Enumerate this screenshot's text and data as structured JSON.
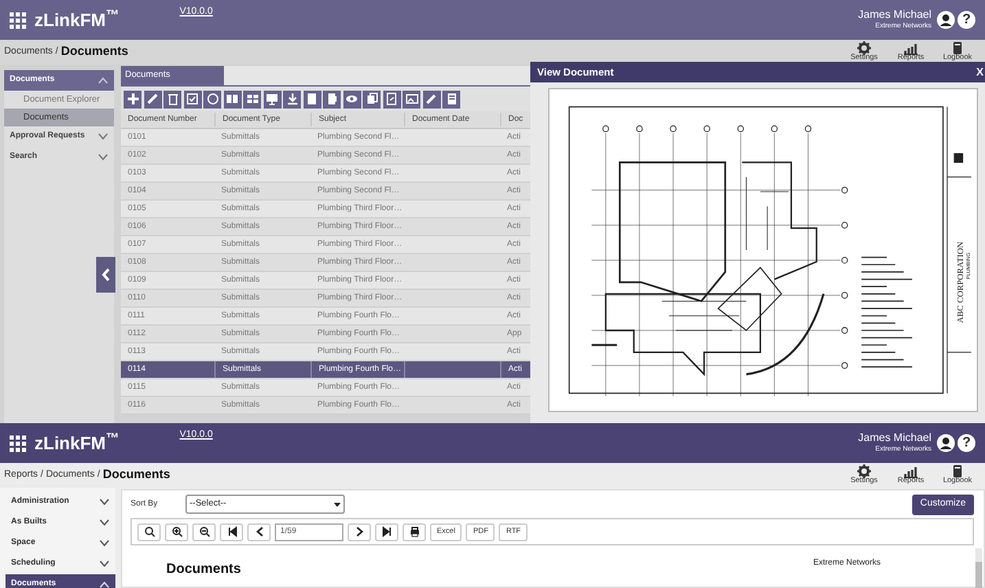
{
  "top_screen": {
    "header": {
      "logo": "zLinkFM$^{™}$",
      "version": "V10.0.0",
      "user_name": "James Michael",
      "organization": "Extreme Networks",
      "help": "?"
    },
    "breadcrumb": {
      "parents": [
        "Documents"
      ],
      "separator": "/",
      "current": "Documents"
    },
    "shortcuts": [
      {
        "label": "Settings"
      },
      {
        "label": "Reports"
      },
      {
        "label": "Logbook"
      }
    ],
    "sidebar": [
      {
        "label": "Documents",
        "expanded": true,
        "children": [
          {
            "label": "Document Explorer",
            "selected": false
          },
          {
            "label": "Documents",
            "selected": true
          }
        ]
      },
      {
        "label": "Approval Requests",
        "expanded": false
      },
      {
        "label": "Search",
        "expanded": false
      }
    ],
    "panel_tab": "Documents",
    "table": {
      "columns": [
        "Document Number",
        "Document Type",
        "Subject",
        "Document Date",
        "Doc"
      ],
      "rows": [
        {
          "cells": [
            "0101",
            "Submittals",
            "Plumbing Second Fl…",
            "",
            "Acti"
          ],
          "selected": false
        },
        {
          "cells": [
            "0102",
            "Submittals",
            "Plumbing Second Fl…",
            "",
            "Acti"
          ],
          "selected": false
        },
        {
          "cells": [
            "0103",
            "Submittals",
            "Plumbing Second Fl…",
            "",
            "Acti"
          ],
          "selected": false
        },
        {
          "cells": [
            "0104",
            "Submittals",
            "Plumbing Second Fl…",
            "",
            "Acti"
          ],
          "selected": false
        },
        {
          "cells": [
            "0105",
            "Submittals",
            "Plumbing Third Floor…",
            "",
            "Acti"
          ],
          "selected": false
        },
        {
          "cells": [
            "0106",
            "Submittals",
            "Plumbing Third Floor…",
            "",
            "Acti"
          ],
          "selected": false
        },
        {
          "cells": [
            "0107",
            "Submittals",
            "Plumbing Third Floor…",
            "",
            "Acti"
          ],
          "selected": false
        },
        {
          "cells": [
            "0108",
            "Submittals",
            "Plumbing Third Floor…",
            "",
            "Acti"
          ],
          "selected": false
        },
        {
          "cells": [
            "0109",
            "Submittals",
            "Plumbing Third Floor…",
            "",
            "Acti"
          ],
          "selected": false
        },
        {
          "cells": [
            "0110",
            "Submittals",
            "Plumbing Third Floor…",
            "",
            "Acti"
          ],
          "selected": false
        },
        {
          "cells": [
            "0111",
            "Submittals",
            "Plumbing Fourth Flo…",
            "",
            "Acti"
          ],
          "selected": false
        },
        {
          "cells": [
            "0112",
            "Submittals",
            "Plumbing Fourth Flo…",
            "",
            "App"
          ],
          "selected": false
        },
        {
          "cells": [
            "0113",
            "Submittals",
            "Plumbing Fourth Flo…",
            "",
            "Acti"
          ],
          "selected": false
        },
        {
          "cells": [
            "0114",
            "Submittals",
            "Plumbing Fourth Flo…",
            "",
            "Acti"
          ],
          "selected": true
        },
        {
          "cells": [
            "0115",
            "Submittals",
            "Plumbing Fourth Flo…",
            "",
            "Acti"
          ],
          "selected": false
        },
        {
          "cells": [
            "0116",
            "Submittals",
            "Plumbing Fourth Flo…",
            "",
            "Acti"
          ],
          "selected": false
        }
      ]
    },
    "viewer": {
      "title": "View Document",
      "close": "X",
      "sheet_title": "ABC CORPORATION",
      "sheet_subtitle": "PLUMBING"
    }
  },
  "bottom_screen": {
    "header": {
      "logo": "zLinkFM$^{™}$",
      "version": "V10.0.0",
      "user_name": "James Michael",
      "organization": "Extreme Networks",
      "help": "?"
    },
    "breadcrumb": {
      "parents": [
        "Reports",
        "Documents"
      ],
      "separator": "/",
      "current": "Documents"
    },
    "shortcuts": [
      {
        "label": "Settings"
      },
      {
        "label": "Reports"
      },
      {
        "label": "Logbook"
      }
    ],
    "sidebar": [
      {
        "label": "Administration",
        "expanded": false
      },
      {
        "label": "As Builts",
        "expanded": false
      },
      {
        "label": "Space",
        "expanded": false
      },
      {
        "label": "Scheduling",
        "expanded": false
      },
      {
        "label": "Documents",
        "expanded": true
      }
    ],
    "sort_label": "Sort By",
    "sort_select": "--Select--",
    "customize": "Customize",
    "report_toolbar": {
      "page": "1/59",
      "exports": [
        "Excel",
        "PDF",
        "RTF"
      ]
    },
    "report_title": "Documents",
    "report_org": "Extreme Networks"
  }
}
